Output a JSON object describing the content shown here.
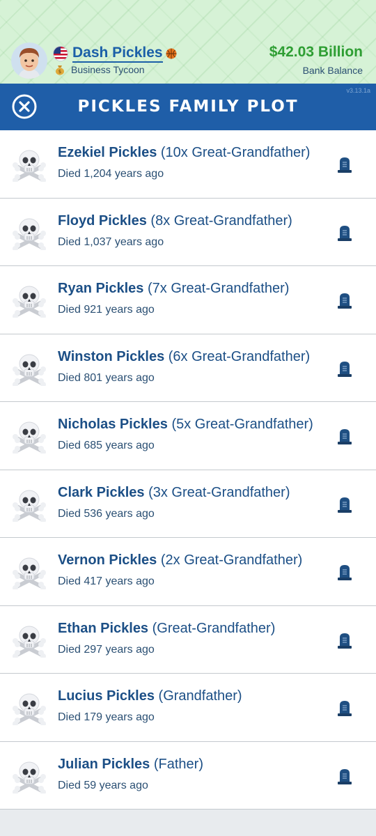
{
  "header": {
    "player_name": "Dash Pickles",
    "player_title": "Business Tycoon",
    "balance": "$42.03 Billion",
    "balance_label": "Bank Balance",
    "colors": {
      "balance": "#2e9e33",
      "name": "#1b5fa8",
      "bar": "#1f5ea8"
    }
  },
  "title_bar": {
    "title": "PICKLES FAMILY PLOT",
    "version": "v3.13.1a"
  },
  "relatives": [
    {
      "name": "Ezekiel Pickles",
      "relation": "(10x Great-Grandfather)",
      "died": "Died 1,204 years ago"
    },
    {
      "name": "Floyd Pickles",
      "relation": "(8x Great-Grandfather)",
      "died": "Died 1,037 years ago"
    },
    {
      "name": "Ryan Pickles",
      "relation": "(7x Great-Grandfather)",
      "died": "Died 921 years ago"
    },
    {
      "name": "Winston Pickles",
      "relation": "(6x Great-Grandfather)",
      "died": "Died 801 years ago"
    },
    {
      "name": "Nicholas Pickles",
      "relation": "(5x Great-Grandfather)",
      "died": "Died 685 years ago"
    },
    {
      "name": "Clark Pickles",
      "relation": "(3x Great-Grandfather)",
      "died": "Died 536 years ago"
    },
    {
      "name": "Vernon Pickles",
      "relation": "(2x Great-Grandfather)",
      "died": "Died 417 years ago"
    },
    {
      "name": "Ethan Pickles",
      "relation": "(Great-Grandfather)",
      "died": "Died 297 years ago"
    },
    {
      "name": "Lucius Pickles",
      "relation": "(Grandfather)",
      "died": "Died 179 years ago"
    },
    {
      "name": "Julian Pickles",
      "relation": "(Father)",
      "died": "Died 59 years ago"
    }
  ],
  "icons": {
    "close": "close-icon",
    "row_left": "skull-crossbones-icon",
    "row_right": "headstone-icon"
  }
}
